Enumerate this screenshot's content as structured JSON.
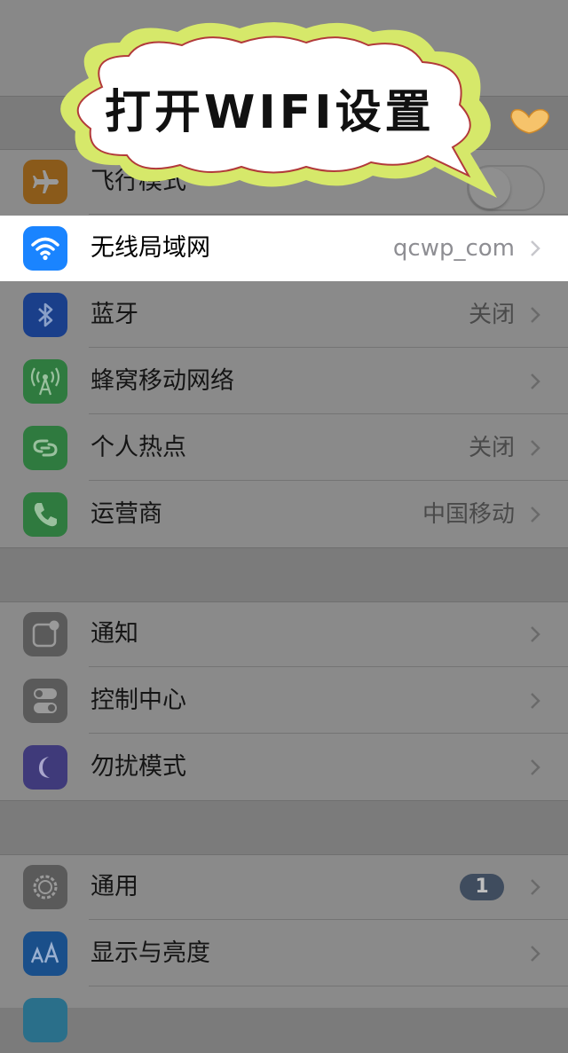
{
  "banner": {
    "text": "打开WIFI设置"
  },
  "groups": [
    {
      "rows": [
        {
          "id": "airplane",
          "label": "飞行模式",
          "value": "",
          "icon": "airplane-icon",
          "icon_color": "#8a5a1a",
          "toggle": true,
          "toggle_on": false
        },
        {
          "id": "wifi",
          "label": "无线局域网",
          "value": "qcwp_com",
          "icon": "wifi-icon",
          "icon_color": "#1a84ff",
          "highlighted": true
        },
        {
          "id": "bluetooth",
          "label": "蓝牙",
          "value": "关闭",
          "icon": "bluetooth-icon",
          "icon_color": "#1a3f8a"
        },
        {
          "id": "cellular",
          "label": "蜂窝移动网络",
          "value": "",
          "icon": "cellular-icon",
          "icon_color": "#2f7a3f"
        },
        {
          "id": "hotspot",
          "label": "个人热点",
          "value": "关闭",
          "icon": "hotspot-icon",
          "icon_color": "#2f7a3f"
        },
        {
          "id": "carrier",
          "label": "运营商",
          "value": "中国移动",
          "icon": "phone-icon",
          "icon_color": "#2f7a3f"
        }
      ]
    },
    {
      "rows": [
        {
          "id": "notifications",
          "label": "通知",
          "value": "",
          "icon": "notifications-icon",
          "icon_color": "#5a5a5a"
        },
        {
          "id": "control_center",
          "label": "控制中心",
          "value": "",
          "icon": "control-center-icon",
          "icon_color": "#5a5a5a"
        },
        {
          "id": "dnd",
          "label": "勿扰模式",
          "value": "",
          "icon": "moon-icon",
          "icon_color": "#3f3a7a"
        }
      ]
    },
    {
      "rows": [
        {
          "id": "general",
          "label": "通用",
          "value": "",
          "badge": "1",
          "icon": "gear-icon",
          "icon_color": "#5a5a5a"
        },
        {
          "id": "display",
          "label": "显示与亮度",
          "value": "",
          "icon": "text-size-icon",
          "icon_color": "#1a4f8a"
        },
        {
          "id": "wallpaper",
          "label": "",
          "value": "",
          "icon": "wallpaper-icon",
          "icon_color": "#2a6f8a"
        }
      ]
    }
  ]
}
